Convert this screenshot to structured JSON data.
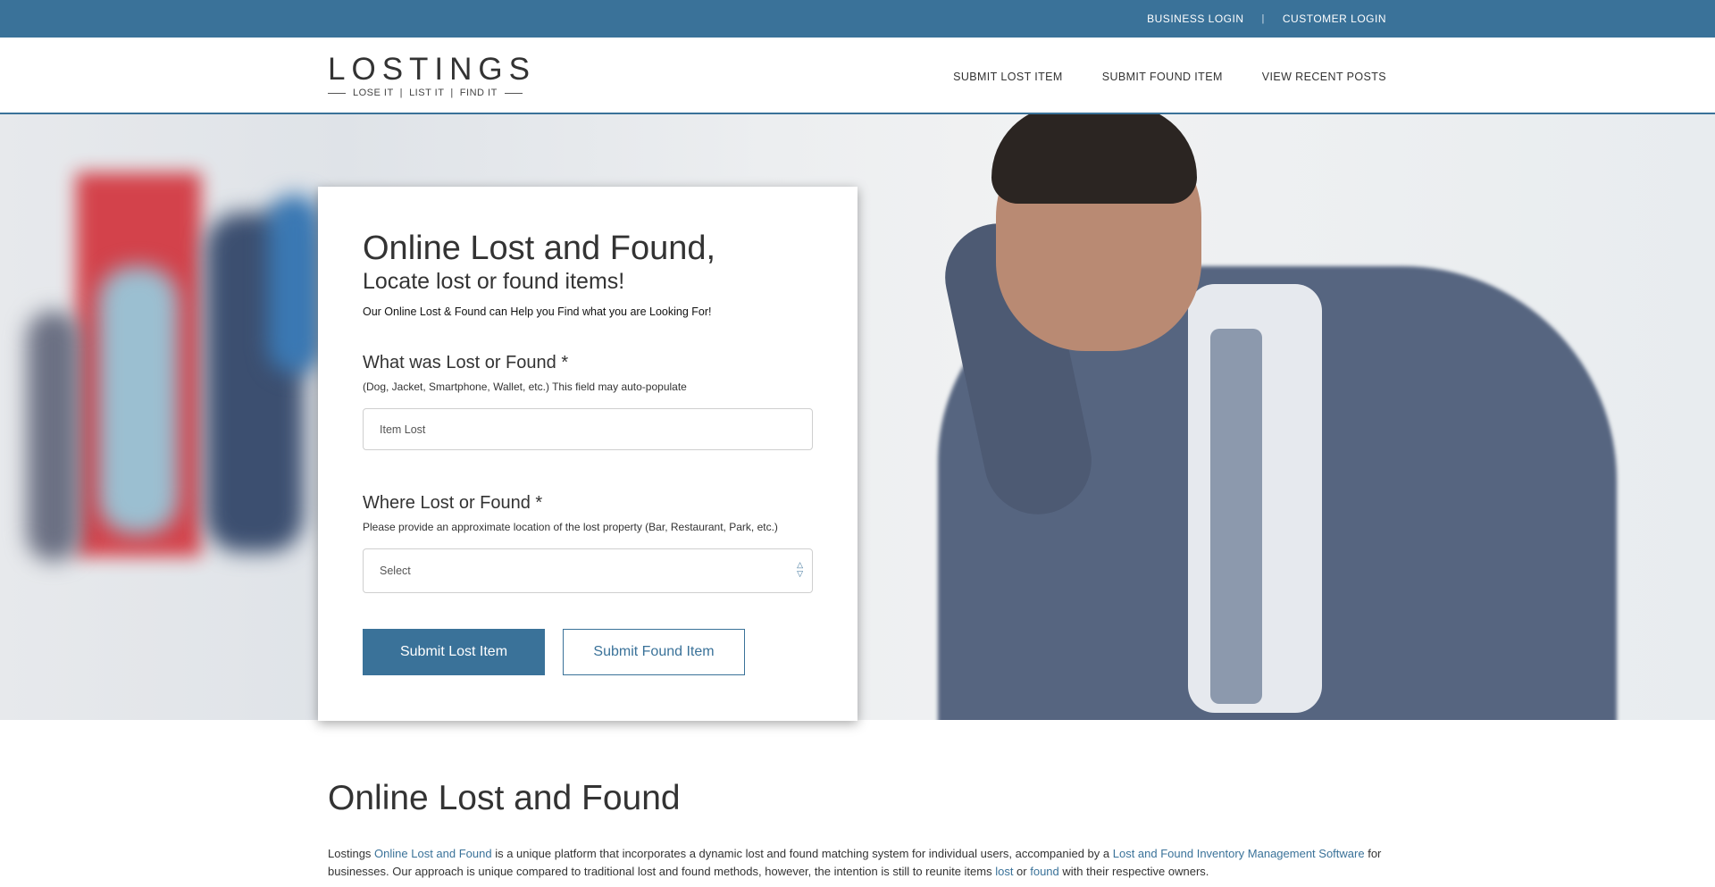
{
  "topbar": {
    "business_login": "BUSINESS LOGIN",
    "separator": "|",
    "customer_login": "CUSTOMER LOGIN"
  },
  "header": {
    "logo_word": "LOSTINGS",
    "logo_tagline": "LOSE IT  |  LIST IT  |  FIND IT",
    "nav": {
      "submit_lost": "SUBMIT LOST ITEM",
      "submit_found": "SUBMIT FOUND ITEM",
      "view_recent": "VIEW RECENT POSTS"
    }
  },
  "form": {
    "title": "Online Lost and Found,",
    "subtitle": "Locate lost or found items!",
    "intro": "Our Online Lost & Found can Help you Find what you are Looking For!",
    "item_question": "What was Lost or Found *",
    "item_hint": "(Dog, Jacket, Smartphone, Wallet, etc.) This field may auto-populate",
    "item_placeholder": "Item Lost",
    "location_question": "Where Lost or Found *",
    "location_hint": "Please provide an approximate location of the lost property (Bar, Restaurant, Park, etc.)",
    "location_selected": "Select",
    "submit_lost_button": "Submit Lost Item",
    "submit_found_button": "Submit Found Item"
  },
  "content": {
    "heading": "Online Lost and Found",
    "p_start": "Lostings ",
    "link_online": "Online Lost and Found",
    "p_mid1": " is a unique platform that incorporates a dynamic lost and found matching system for individual users, accompanied by a ",
    "link_software": "Lost and Found Inventory Management Software",
    "p_mid2": " for businesses. Our approach is unique compared to traditional lost and found methods, however, the intention is still to reunite items ",
    "link_lost": "lost",
    "p_or": " or ",
    "link_found": "found",
    "p_end": " with their respective owners."
  },
  "colors": {
    "brand_blue": "#3a7299",
    "text": "#333333"
  },
  "icons": {
    "select_arrows": "up-down-chevron-icon"
  }
}
